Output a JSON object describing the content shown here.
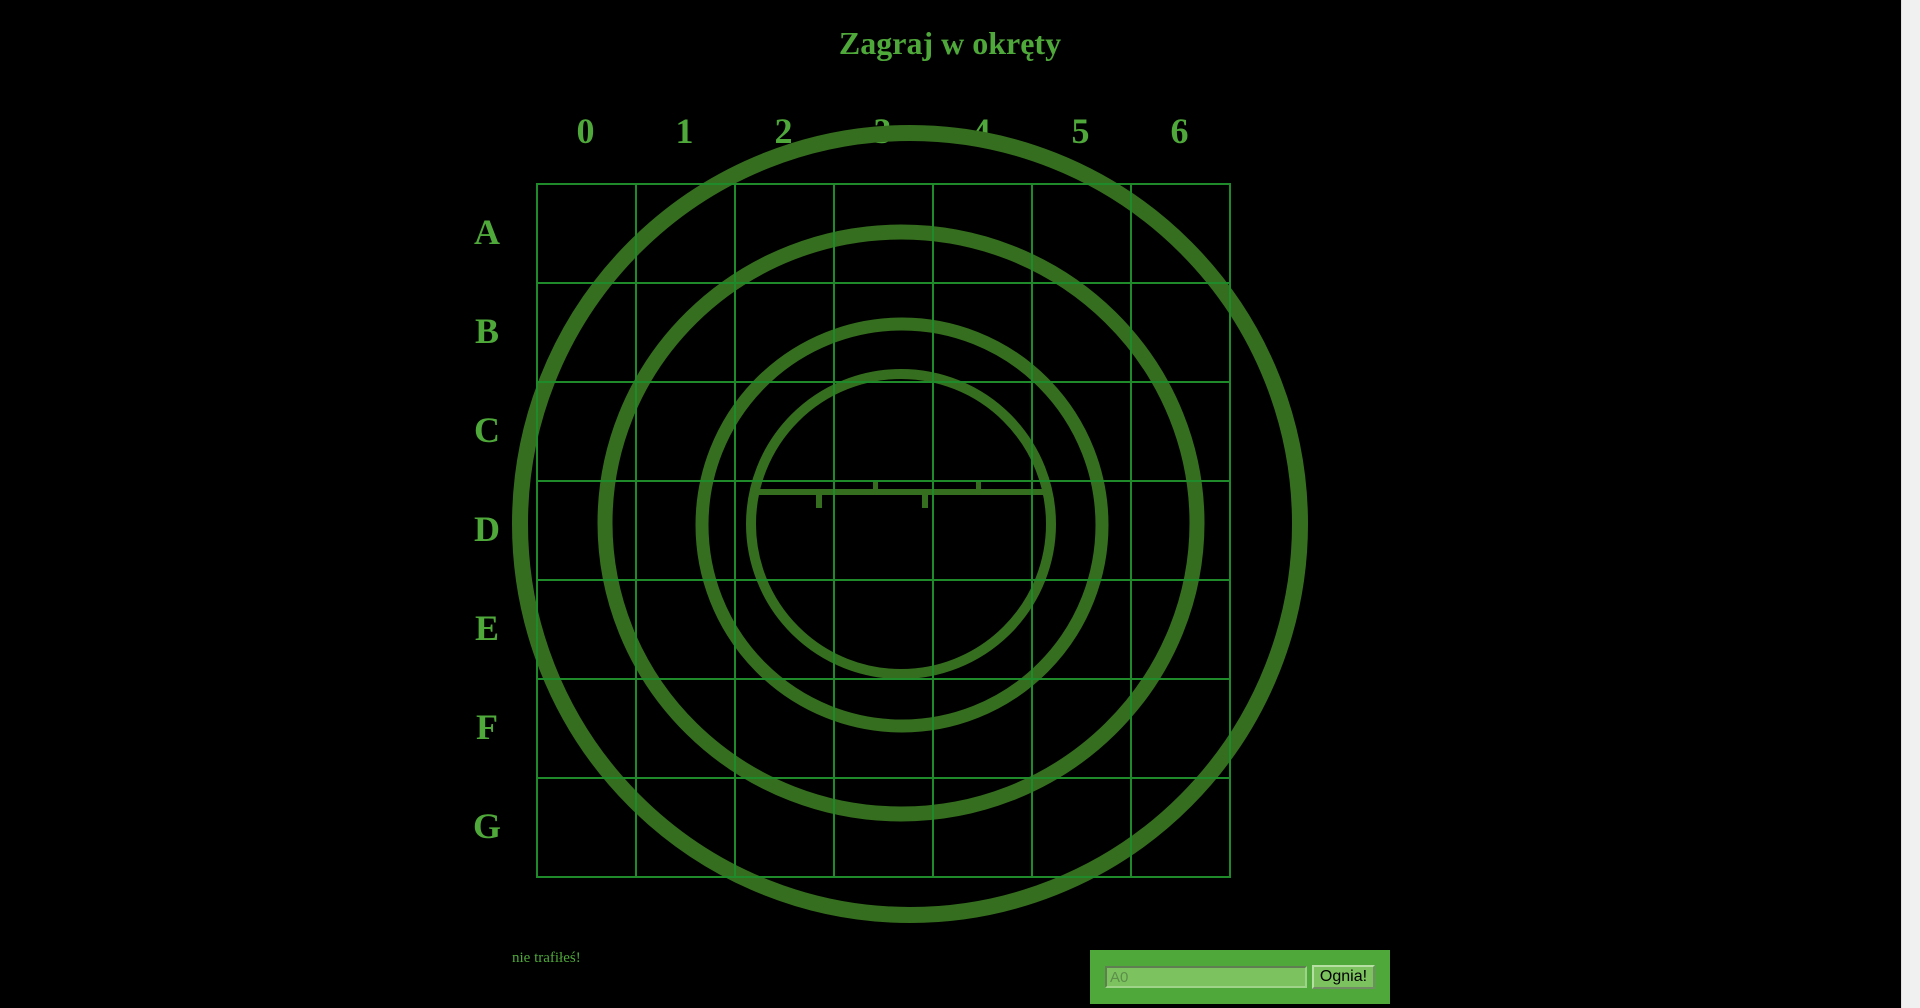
{
  "title": "Zagraj w okręty",
  "board": {
    "columns": [
      "0",
      "1",
      "2",
      "3",
      "4",
      "5",
      "6"
    ],
    "rows": [
      "A",
      "B",
      "C",
      "D",
      "E",
      "F",
      "G"
    ],
    "cell_states": "all empty"
  },
  "message": "nie trafiłeś!",
  "form": {
    "guess_placeholder": "A0",
    "guess_value": "",
    "fire_label": "Ognia!"
  },
  "colors": {
    "background": "#000000",
    "accent": "#4fa83a",
    "grid": "#1f8a2a",
    "radar": "#356e1e",
    "form_bg": "#4fa83a"
  },
  "icons": [
    "radar-icon"
  ]
}
